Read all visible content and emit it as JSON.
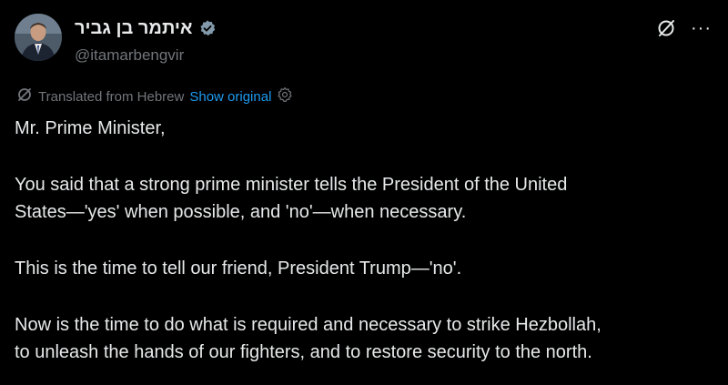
{
  "author": {
    "display_name": "איתמר בן גביר",
    "handle": "@itamarbengvir",
    "verified": true,
    "avatar": "profile-photo"
  },
  "header_actions": {
    "grok_icon": "slashed-circle-icon",
    "more_label": "···"
  },
  "translation": {
    "label": "Translated from Hebrew",
    "show_original": "Show original",
    "icon": "translate-icon",
    "settings_icon": "gear-icon"
  },
  "post": {
    "greeting": "Mr. Prime Minister,",
    "paragraph_1": "You said that a strong prime minister tells the President of the United\nStates—'yes' when possible, and 'no'—when necessary.",
    "paragraph_2": "This is the time to tell our friend, President Trump—'no'.",
    "paragraph_3": "Now is the time to do what is required and necessary to strike Hezbollah,\nto unleash the hands of our fighters, and to restore security to the north."
  },
  "colors": {
    "background": "#000000",
    "text": "#e7e9ea",
    "secondary": "#71767b",
    "link": "#1d9bf0",
    "verified_badge": "#829aab"
  }
}
